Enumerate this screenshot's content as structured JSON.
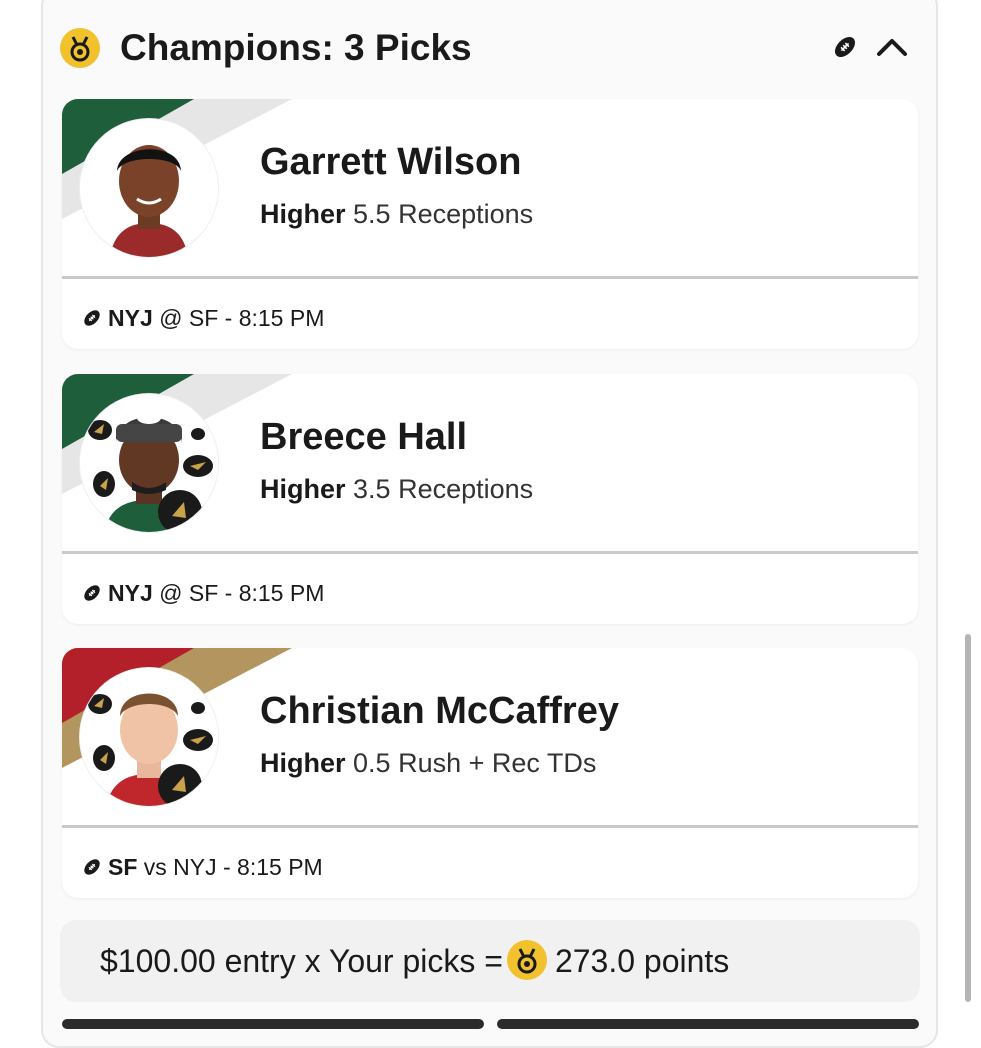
{
  "header": {
    "title": "Champions: 3 Picks",
    "medal_icon": "medal-icon",
    "sport_icon": "football-icon",
    "collapse_icon": "chevron-up-icon"
  },
  "picks": [
    {
      "player": "Garrett Wilson",
      "direction": "Higher",
      "line": "5.5 Receptions",
      "game_team": "NYJ",
      "game_rest": "@ SF - 8:15 PM",
      "team_colors": [
        "#1f5e3b",
        "#e6e6e6"
      ]
    },
    {
      "player": "Breece Hall",
      "direction": "Higher",
      "line": "3.5 Receptions",
      "game_team": "NYJ",
      "game_rest": "@ SF - 8:15 PM",
      "team_colors": [
        "#1f5e3b",
        "#e6e6e6"
      ]
    },
    {
      "player": "Christian McCaffrey",
      "direction": "Higher",
      "line": "0.5 Rush + Rec TDs",
      "game_team": "SF",
      "game_rest": "vs NYJ - 8:15 PM",
      "team_colors": [
        "#b3202a",
        "#b39560"
      ]
    }
  ],
  "summary": {
    "prefix": "$100.00 entry x Your picks =",
    "points": "273.0 points"
  },
  "colors": {
    "accent_gold": "#f2c12e",
    "panel_bg": "#fafafa",
    "divider": "#c9c9c9"
  }
}
